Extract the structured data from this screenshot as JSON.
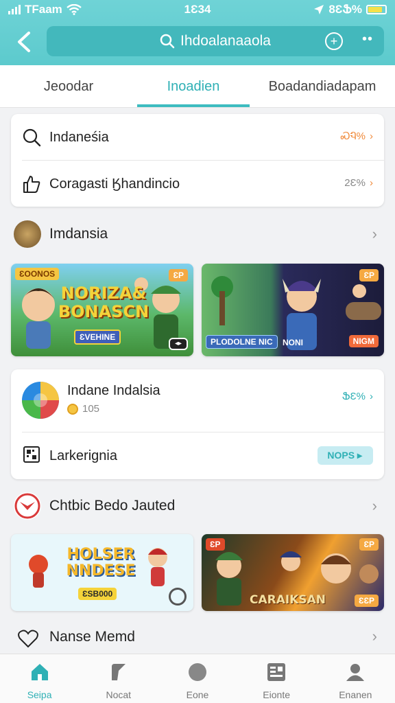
{
  "status": {
    "carrier": "TFaam",
    "time": "1Ɛ34",
    "battery": "8ƐՖ%"
  },
  "search": {
    "query": "Ihdoalanaaola"
  },
  "tabs": [
    {
      "label": "Jeoodar"
    },
    {
      "label": "Inoadien"
    },
    {
      "label": "Boadandiadapam"
    }
  ],
  "card1": {
    "rows": [
      {
        "label": "Indaneśia",
        "value": "ᏍᏄ%",
        "icon": "search-icon"
      },
      {
        "label": "Coragasti Ӄhandincio",
        "value": "2Ɛ%",
        "icon": "thumb-up-icon"
      }
    ]
  },
  "section1": {
    "label": "Imdansia"
  },
  "banners1": [
    {
      "title": "NORIZA& BONASCN",
      "tag_left": "ƐOONOS",
      "tag_right": "ƐP",
      "button": "ƐVEHINE"
    },
    {
      "title": "",
      "tag_right": "ƐP",
      "label_left": "PLODOLNE NIC",
      "label_mid": "NONI",
      "button": "NIGM"
    }
  ],
  "card2": {
    "rows": [
      {
        "label": "Indane Indalsia",
        "value": "ՖƐ%",
        "coins": "105",
        "icon": "colorful-ball-icon"
      },
      {
        "label": "Larkerignia",
        "value": "NOPS",
        "icon": "qr-code-icon"
      }
    ]
  },
  "section2": {
    "label": "Chtbic Bedo Jauted"
  },
  "banners2": [
    {
      "title": "HOLSER NNDESE",
      "sub": "ƐSB000"
    },
    {
      "title": "CARAIKSAN",
      "tag_left": "ƐP",
      "tag_right": "ƐP",
      "button": "ƐƐP"
    }
  ],
  "section3": {
    "label": "Nanse Memd"
  },
  "nav": [
    {
      "label": "Seipa",
      "icon": "home-icon"
    },
    {
      "label": "Nocat",
      "icon": "pen-icon"
    },
    {
      "label": "Eone",
      "icon": "circle-icon"
    },
    {
      "label": "Eionte",
      "icon": "grid-icon"
    },
    {
      "label": "Enanen",
      "icon": "profile-icon"
    }
  ],
  "colors": {
    "accent": "#3dbcc0",
    "orange": "#f08a3a",
    "teal": "#2fb0b5"
  }
}
